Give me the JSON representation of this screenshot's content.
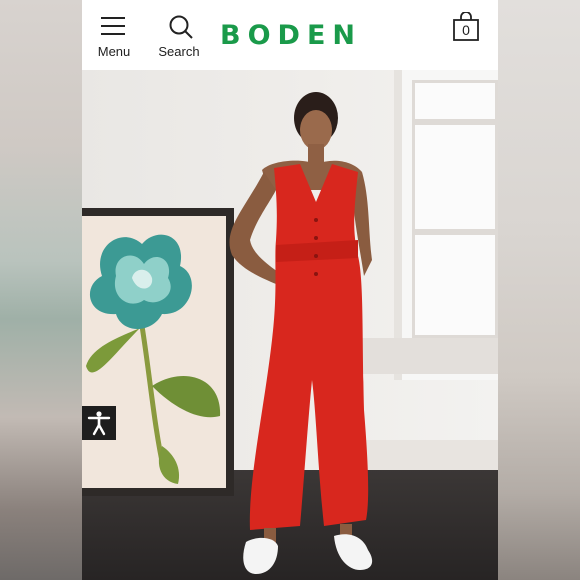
{
  "header": {
    "menu_label": "Menu",
    "search_label": "Search",
    "logo_text": "BODEN",
    "bag_count": "0"
  },
  "icons": {
    "menu": "hamburger-icon",
    "search": "search-icon",
    "bag": "shopping-bag-icon",
    "accessibility": "accessibility-icon"
  },
  "colors": {
    "brand": "#1a9a4a",
    "jumpsuit": "#d8271e",
    "header_bg": "#ffffff"
  }
}
